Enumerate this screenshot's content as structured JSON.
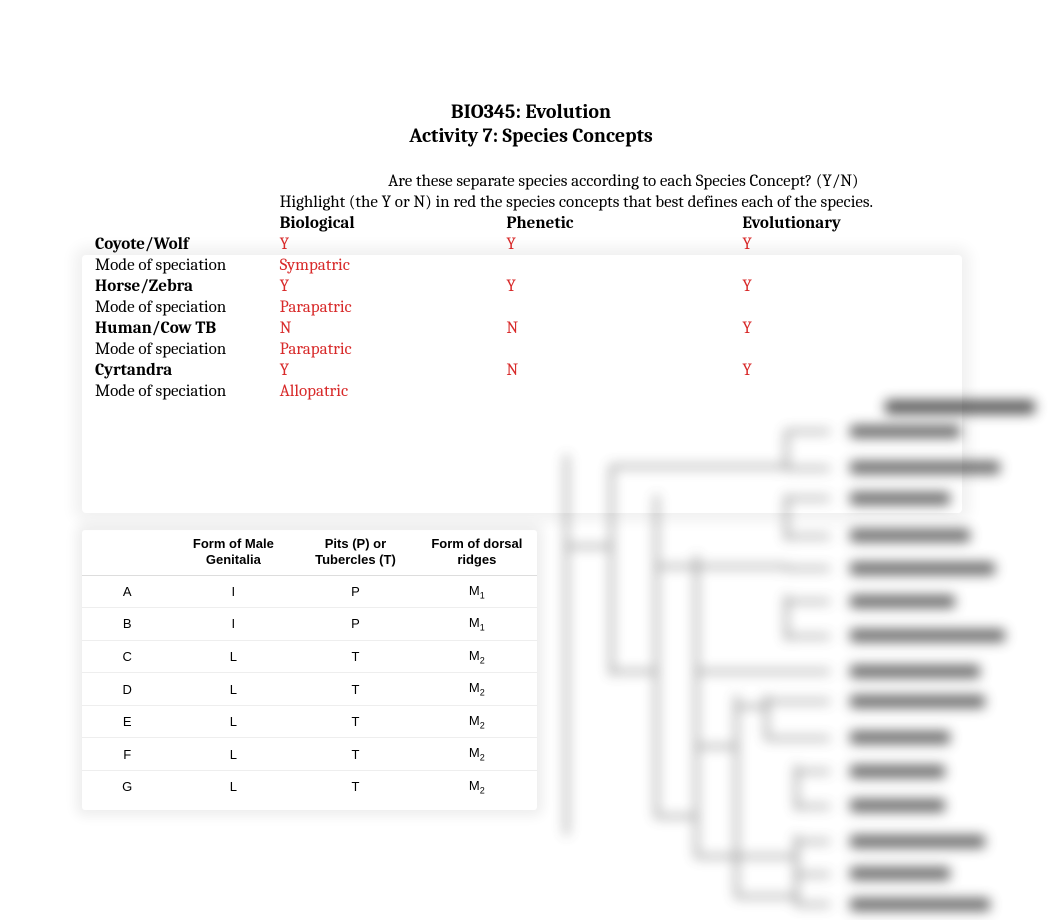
{
  "title": {
    "course": "BIO345: Evolution",
    "activity": "Activity 7: Species Concepts"
  },
  "question": "Are these separate species according to each Species Concept?   (Y/N)",
  "instruction": "Highlight (the Y or N) in red the species concepts that best defines each of the species.",
  "columns": {
    "bio": "Biological",
    "phen": "Phenetic",
    "evo": "Evolutionary"
  },
  "rows": [
    {
      "label": "Coyote/Wolf",
      "bio": "Y",
      "phen": "Y",
      "evo": "Y",
      "mode": "Sympatric"
    },
    {
      "label": "Horse/Zebra",
      "bio": "Y",
      "phen": "Y",
      "evo": "Y",
      "mode": "Parapatric"
    },
    {
      "label": "Human/Cow TB",
      "bio": "N",
      "phen": "N",
      "evo": "Y",
      "mode": "Parapatric"
    },
    {
      "label": "Cyrtandra",
      "bio": "Y",
      "phen": "N",
      "evo": "Y",
      "mode": "Allopatric"
    }
  ],
  "mode_label": "Mode of speciation",
  "morph_headers": {
    "id": "",
    "c1": "Form of Male Genitalia",
    "c2": "Pits (P) or Tubercles (T)",
    "c3": "Form of dorsal ridges"
  },
  "morph_rows": [
    {
      "id": "A",
      "c1": "I",
      "c2": "P",
      "c3": "M",
      "sub": "1"
    },
    {
      "id": "B",
      "c1": "I",
      "c2": "P",
      "c3": "M",
      "sub": "1"
    },
    {
      "id": "C",
      "c1": "L",
      "c2": "T",
      "c3": "M",
      "sub": "2"
    },
    {
      "id": "D",
      "c1": "L",
      "c2": "T",
      "c3": "M",
      "sub": "2"
    },
    {
      "id": "E",
      "c1": "L",
      "c2": "T",
      "c3": "M",
      "sub": "2"
    },
    {
      "id": "F",
      "c1": "L",
      "c2": "T",
      "c3": "M",
      "sub": "2"
    },
    {
      "id": "G",
      "c1": "L",
      "c2": "T",
      "c3": "M",
      "sub": "2"
    }
  ]
}
